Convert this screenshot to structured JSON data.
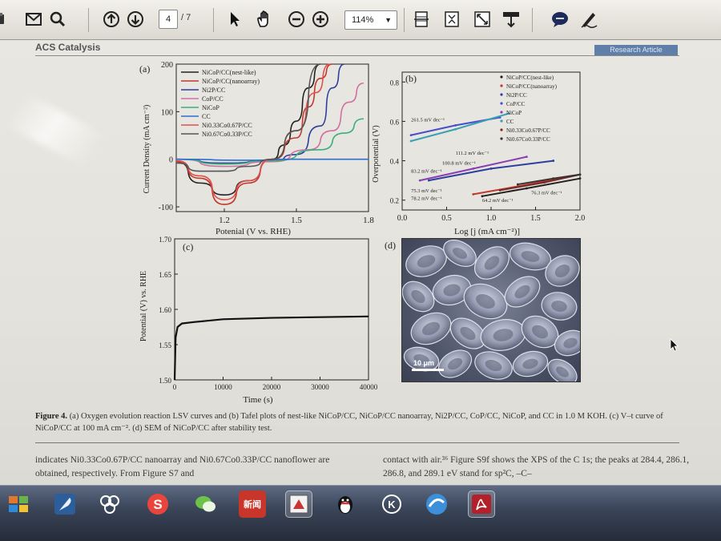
{
  "toolbar": {
    "page_current": "4",
    "page_total": "/ 7",
    "zoom": "114%",
    "zoom_dropdown_icon": "chevron-down-icon",
    "icons": [
      "print-icon",
      "mail-icon",
      "search-icon",
      "page-up-icon",
      "page-down-icon",
      "select-arrow-icon",
      "hand-tool-icon",
      "zoom-out-icon",
      "zoom-in-icon",
      "fit-width-icon",
      "fit-page-icon",
      "fullscreen-icon",
      "read-mode-icon",
      "comment-icon",
      "sign-pen-icon"
    ]
  },
  "document": {
    "journal": "ACS Catalysis",
    "article_type": "Research Article",
    "figure": {
      "panel_a": {
        "label": "(a)",
        "ylabel": "Current Density (mA cm⁻²)",
        "xlabel": "Potenial (V vs. RHE)",
        "yticks": [
          "200",
          "100",
          "0",
          "-100"
        ],
        "xticks": [
          "1.2",
          "1.5",
          "1.8"
        ],
        "legend": [
          "NiCoP/CC(nest-like)",
          "NiCoP/CC(nanoarray)",
          "Ni2P/CC",
          "CoP/CC",
          "NiCoP",
          "CC",
          "Ni0.33Co0.67P/CC",
          "Ni0.67Co0.33P/CC"
        ]
      },
      "panel_b": {
        "label": "(b)",
        "ylabel": "Overpotential (V)",
        "xlabel": "Log [j (mA cm⁻²)]",
        "yticks": [
          "0.8",
          "0.6",
          "0.4",
          "0.2"
        ],
        "xticks": [
          "0.0",
          "0.5",
          "1.0",
          "1.5",
          "2.0"
        ],
        "slopes": [
          "261.5 mV dec⁻¹",
          "111.2 mV dec⁻¹",
          "100.8 mV dec⁻¹",
          "83.2 mV dec⁻¹",
          "75.3 mV dec⁻¹",
          "78.2 mV dec⁻¹",
          "64.2 mV dec⁻¹",
          "76.3 mV dec⁻¹"
        ],
        "legend": [
          "NiCoP/CC(nest-like)",
          "NiCoP/CC(nanoarray)",
          "Ni2P/CC",
          "CoP/CC",
          "NiCoP",
          "CC",
          "Ni0.33Co0.67P/CC",
          "Ni0.67Co0.33P/CC"
        ]
      },
      "panel_c": {
        "label": "(c)",
        "ylabel": "Potential (V) vs. RHE",
        "xlabel": "Time (s)",
        "yticks": [
          "1.70",
          "1.65",
          "1.60",
          "1.55",
          "1.50"
        ],
        "xticks": [
          "0",
          "10000",
          "20000",
          "30000",
          "40000"
        ]
      },
      "panel_d": {
        "label": "(d)",
        "scalebar": "10 μm"
      },
      "caption_lead": "Figure 4.",
      "caption": "(a) Oxygen evolution reaction LSV curves and (b) Tafel plots of nest-like NiCoP/CC, NiCoP/CC nanoarray, Ni2P/CC, CoP/CC, NiCoP, and CC in 1.0 M KOH. (c) V–t curve of NiCoP/CC at 100 mA cm⁻². (d) SEM of NiCoP/CC after stability test."
    },
    "body_left": "indicates Ni0.33Co0.67P/CC nanoarray and Ni0.67Co0.33P/CC nanoflower are obtained, respectively. From Figure S7 and",
    "body_right": "contact with air.³⁶ Figure S9f shows the XPS of the C 1s; the peaks at 284.4, 286.1, 286.8, and 289.1 eV stand for sp²C, –C–"
  },
  "taskbar": {
    "apps": [
      "start-icon",
      "feather-app-icon",
      "network-app-icon",
      "sogou-app-icon",
      "wechat-app-icon",
      "news-app-icon",
      "acrobat-task-icon",
      "qq-penguin-icon",
      "k-app-icon",
      "globe-app-icon",
      "pdf-reader-icon"
    ],
    "news_label": "新闻"
  },
  "chart_data": [
    {
      "type": "line",
      "title": "(a)",
      "xlabel": "Potenial (V vs. RHE)",
      "ylabel": "Current Density (mA cm⁻²)",
      "xlim": [
        1.0,
        1.8
      ],
      "ylim": [
        -110,
        200
      ],
      "series": [
        {
          "name": "NiCoP/CC(nest-like)",
          "color": "#222222",
          "x": [
            1.0,
            1.1,
            1.2,
            1.3,
            1.4,
            1.45,
            1.5,
            1.55,
            1.6
          ],
          "y": [
            -5,
            -50,
            -75,
            -45,
            0,
            30,
            80,
            150,
            200
          ]
        },
        {
          "name": "NiCoP/CC(nanoarray)",
          "color": "#c0392b",
          "x": [
            1.0,
            1.1,
            1.2,
            1.3,
            1.4,
            1.5,
            1.55,
            1.6,
            1.65
          ],
          "y": [
            -5,
            -40,
            -95,
            -50,
            0,
            45,
            110,
            170,
            200
          ]
        },
        {
          "name": "Ni2P/CC",
          "color": "#2d3f9e",
          "x": [
            1.0,
            1.2,
            1.4,
            1.5,
            1.6,
            1.65,
            1.7
          ],
          "y": [
            0,
            -8,
            -3,
            10,
            70,
            150,
            200
          ]
        },
        {
          "name": "CoP/CC",
          "color": "#d070a0",
          "x": [
            1.0,
            1.2,
            1.4,
            1.55,
            1.65,
            1.72,
            1.78
          ],
          "y": [
            0,
            -15,
            -5,
            20,
            60,
            120,
            160
          ]
        },
        {
          "name": "NiCoP",
          "color": "#38b07a",
          "x": [
            1.0,
            1.2,
            1.4,
            1.6,
            1.7,
            1.78
          ],
          "y": [
            0,
            -10,
            -3,
            20,
            55,
            85
          ]
        },
        {
          "name": "CC",
          "color": "#2f6fd0",
          "x": [
            1.0,
            1.3,
            1.5,
            1.8
          ],
          "y": [
            0,
            -2,
            0,
            0
          ]
        },
        {
          "name": "Ni0.33Co0.67P/CC",
          "color": "#e05050",
          "x": [
            1.0,
            1.1,
            1.2,
            1.3,
            1.4,
            1.5,
            1.58,
            1.64
          ],
          "y": [
            -3,
            -35,
            -85,
            -45,
            0,
            60,
            140,
            200
          ]
        },
        {
          "name": "Ni0.67Co0.33P/CC",
          "color": "#555555",
          "x": [
            1.0,
            1.1,
            1.2,
            1.3,
            1.4,
            1.5,
            1.6
          ],
          "y": [
            -8,
            -25,
            -25,
            -15,
            0,
            60,
            200
          ]
        }
      ]
    },
    {
      "type": "scatter",
      "title": "(b)",
      "xlabel": "Log [j (mA cm⁻²)]",
      "ylabel": "Overpotential (V)",
      "xlim": [
        0,
        2.0
      ],
      "ylim": [
        0.15,
        0.85
      ],
      "series": [
        {
          "name": "NiCoP/CC(nest-like)",
          "x": [
            0.9,
            1.4,
            2.0
          ],
          "y": [
            0.22,
            0.26,
            0.31
          ]
        },
        {
          "name": "NiCoP/CC(nanoarray)",
          "x": [
            0.8,
            1.3,
            2.0
          ],
          "y": [
            0.23,
            0.27,
            0.33
          ]
        },
        {
          "name": "Ni2P/CC",
          "x": [
            0.3,
            1.0,
            1.7
          ],
          "y": [
            0.3,
            0.36,
            0.4
          ]
        },
        {
          "name": "CoP/CC",
          "x": [
            0.1,
            0.6,
            1.1
          ],
          "y": [
            0.53,
            0.58,
            0.62
          ]
        },
        {
          "name": "NiCoP",
          "x": [
            0.2,
            0.8,
            1.4
          ],
          "y": [
            0.3,
            0.36,
            0.42
          ]
        },
        {
          "name": "CC",
          "x": [
            0.1,
            0.6,
            1.2
          ],
          "y": [
            0.5,
            0.56,
            0.64
          ]
        },
        {
          "name": "Ni0.33Co0.67P/CC",
          "x": [
            1.1,
            1.6,
            2.0
          ],
          "y": [
            0.25,
            0.29,
            0.33
          ]
        },
        {
          "name": "Ni0.67Co0.33P/CC",
          "x": [
            1.3,
            1.7,
            2.0
          ],
          "y": [
            0.28,
            0.31,
            0.33
          ]
        }
      ]
    },
    {
      "type": "line",
      "title": "(c)",
      "xlabel": "Time (s)",
      "ylabel": "Potential (V) vs. RHE",
      "xlim": [
        0,
        40000
      ],
      "ylim": [
        1.5,
        1.7
      ],
      "series": [
        {
          "name": "NiCoP/CC",
          "x": [
            0,
            200,
            600,
            1500,
            4000,
            10000,
            20000,
            30000,
            40000
          ],
          "y": [
            1.5,
            1.56,
            1.575,
            1.58,
            1.582,
            1.586,
            1.588,
            1.589,
            1.59
          ]
        }
      ]
    }
  ]
}
